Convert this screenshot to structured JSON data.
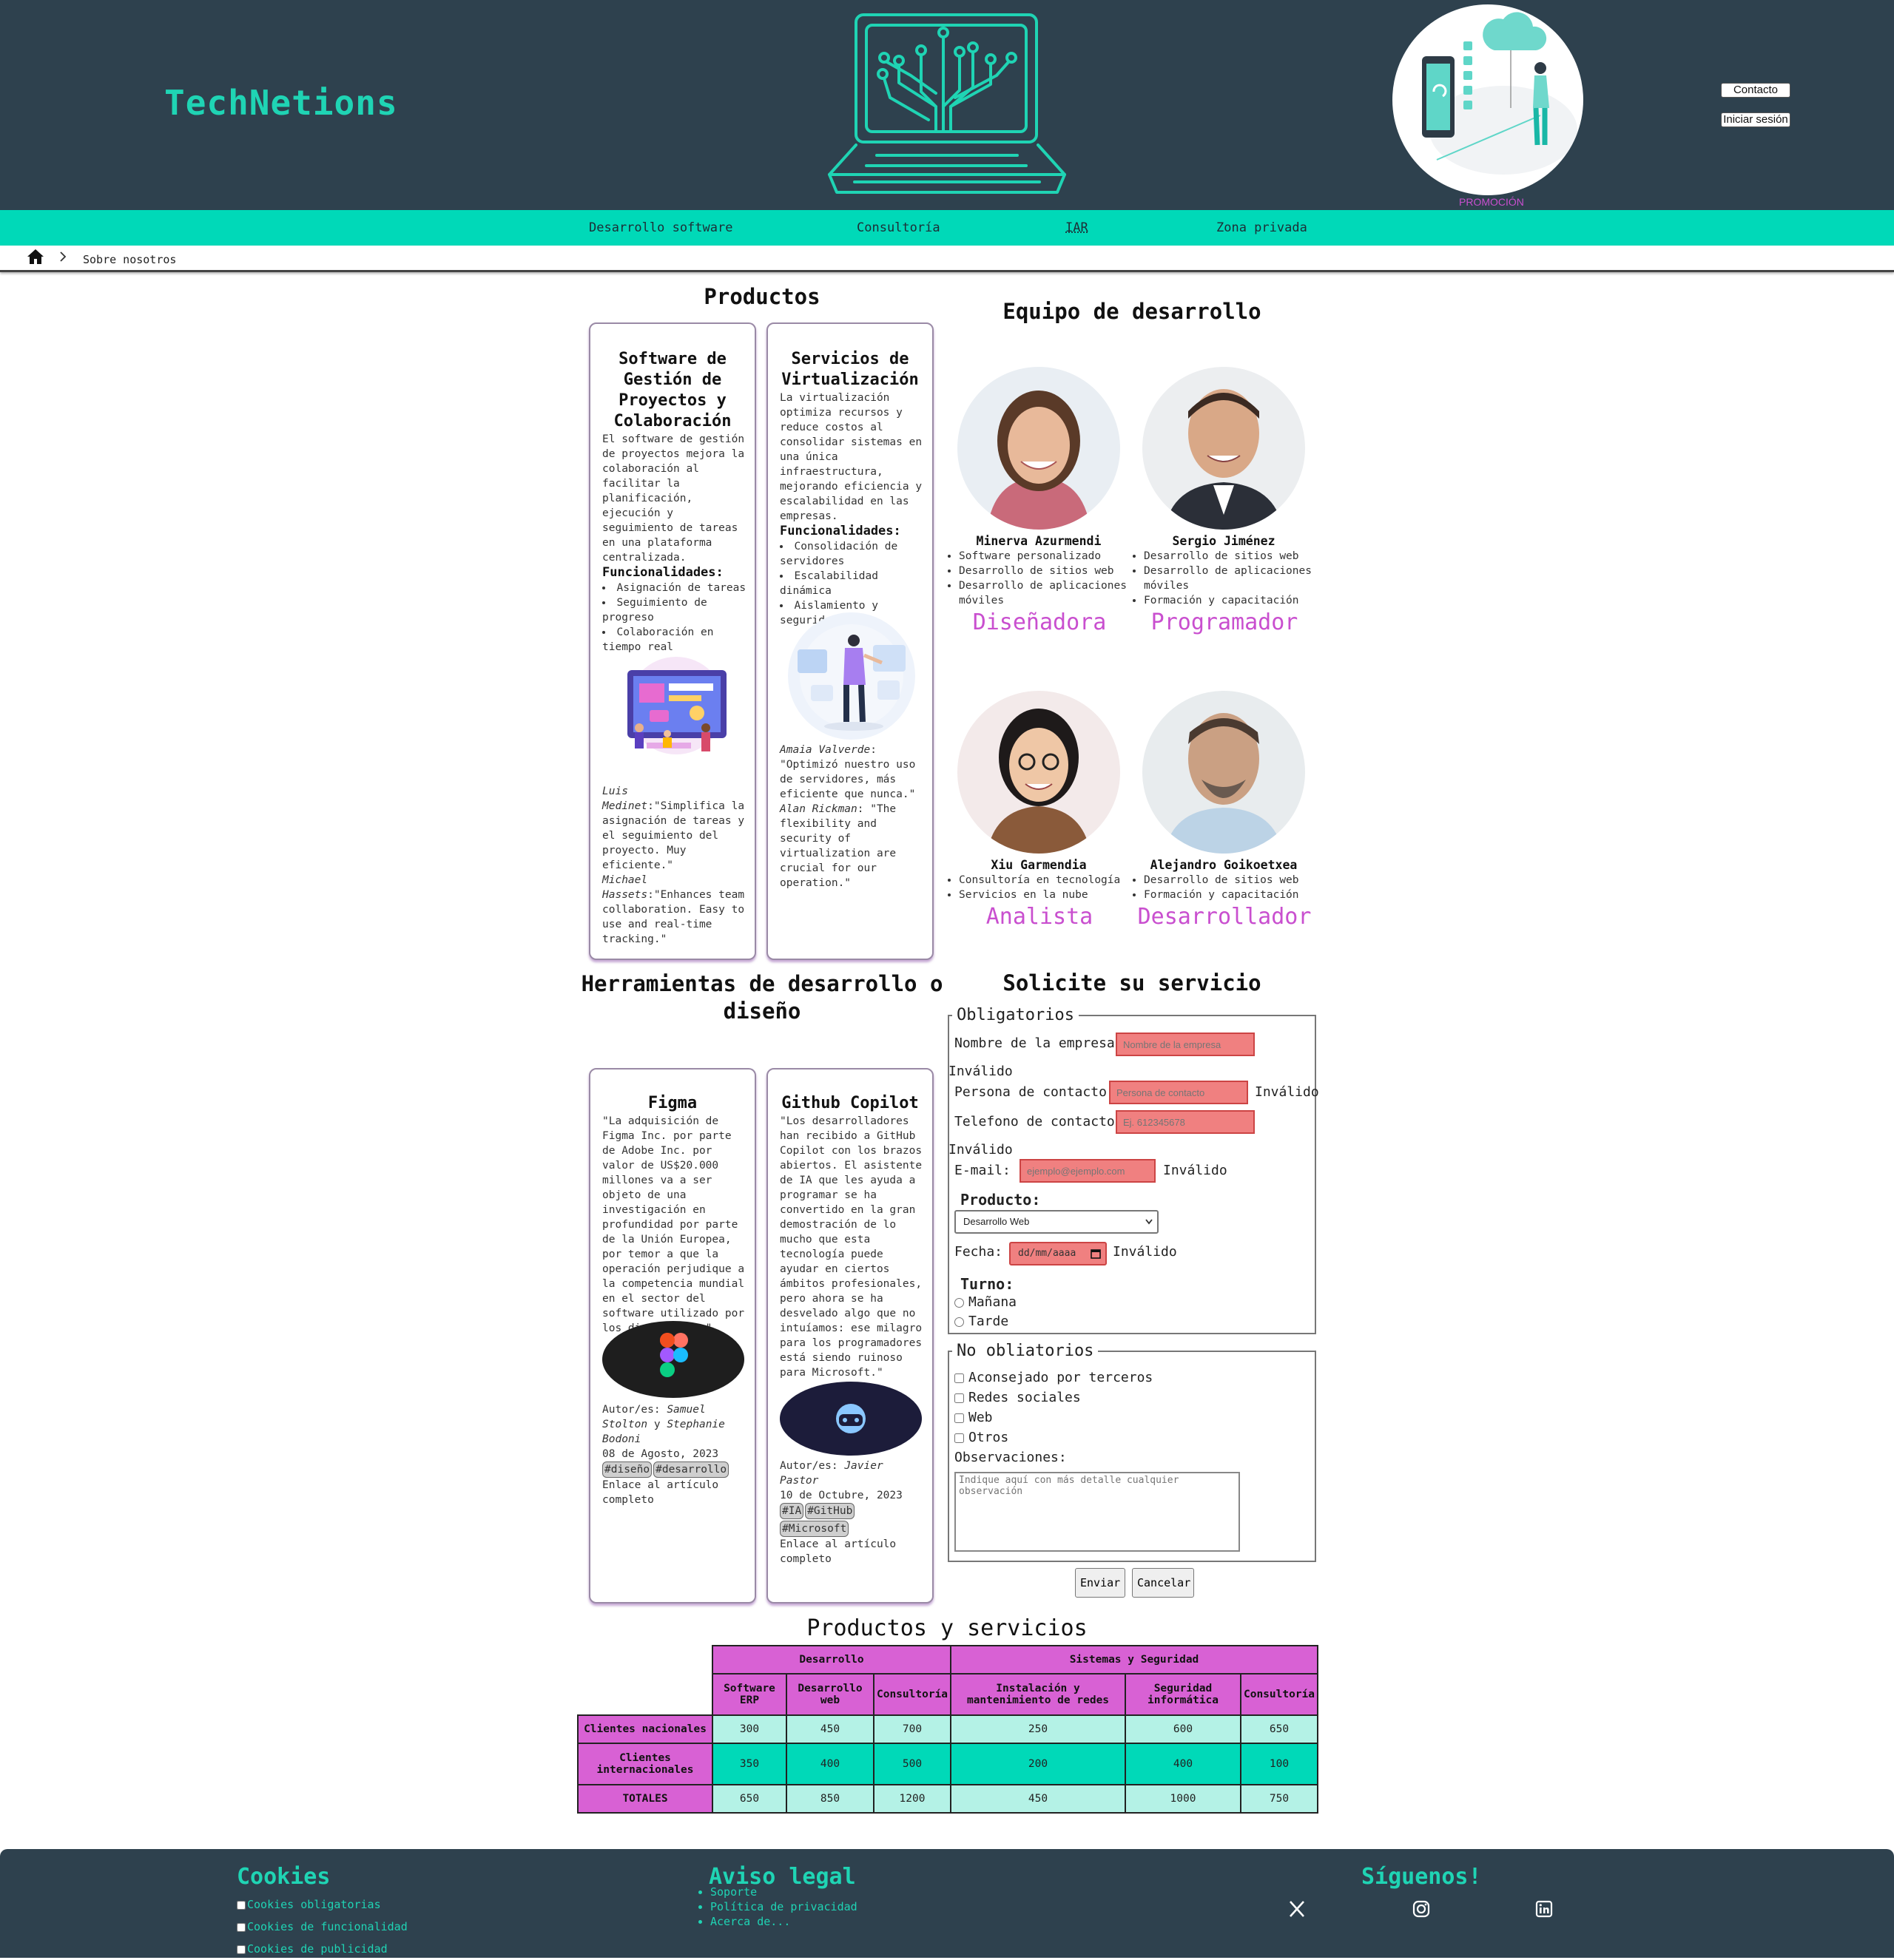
{
  "header": {
    "brand": "TechNetions",
    "promo_label": "PROMOCIÓN",
    "contact_button": "Contacto",
    "login_button": "Iniciar sesión"
  },
  "nav": {
    "items": [
      {
        "label": "Desarrollo software"
      },
      {
        "label": "Consultoría"
      },
      {
        "label": "IAR"
      },
      {
        "label": "Zona privada"
      }
    ]
  },
  "breadcrumb": {
    "current": "Sobre nosotros"
  },
  "products": {
    "title": "Productos",
    "cards": [
      {
        "title": "Software de Gestión de Proyectos y Colaboración",
        "description": "El software de gestión de proyectos mejora la colaboración al facilitar la planificación, ejecución y seguimiento de tareas en una plataforma centralizada.",
        "features_label": "Funcionalidades:",
        "features": [
          "Asignación de tareas",
          "Seguimiento de progreso",
          "Colaboración en tiempo real"
        ],
        "reviews": [
          {
            "author": "Luis Medinet",
            "text": ":\"Simplifica la asignación de tareas y el seguimiento del proyecto. Muy eficiente.\""
          },
          {
            "author": "Michael Hassets",
            "text": ":\"Enhances team collaboration. Easy to use and real-time tracking.\""
          }
        ]
      },
      {
        "title": "Servicios de Virtualización",
        "description": "La virtualización optimiza recursos y reduce costos al consolidar sistemas en una única infraestructura, mejorando eficiencia y escalabilidad en las empresas.",
        "features_label": "Funcionalidades:",
        "features": [
          "Consolidación de servidores",
          "Escalabilidad dinámica",
          "Aislamiento y seguridad"
        ],
        "reviews": [
          {
            "author": "Amaia Valverde",
            "text": ": \"Optimizó nuestro uso de servidores, más eficiente que nunca.\""
          },
          {
            "author": "Alan Rickman",
            "text": ": \"The flexibility and security of virtualization are crucial for our operation.\""
          }
        ]
      }
    ]
  },
  "team": {
    "title": "Equipo de desarrollo",
    "members": [
      {
        "name": "Minerva Azurmendi",
        "skills": [
          "Software personalizado",
          "Desarrollo de sitios web",
          "Desarrollo de aplicaciones móviles"
        ],
        "role": "Diseñadora"
      },
      {
        "name": "Sergio Jiménez",
        "skills": [
          "Desarrollo de sitios web",
          "Desarrollo de aplicaciones móviles",
          "Formación y capacitación"
        ],
        "role": "Programador"
      },
      {
        "name": "Xiu Garmendia",
        "skills": [
          "Consultoría en tecnología",
          "Servicios en la nube"
        ],
        "role": "Analista"
      },
      {
        "name": "Alejandro Goikoetxea",
        "skills": [
          "Desarrollo de sitios web",
          "Formación y capacitación"
        ],
        "role": "Desarrollador"
      }
    ]
  },
  "tools": {
    "title": "Herramientas de desarrollo o diseño",
    "cards": [
      {
        "title": "Figma",
        "text": "\"La adquisición de Figma Inc. por parte de Adobe Inc. por valor de US$20.000 millones va a ser objeto de una investigación en profundidad por parte de la Unión Europea, por temor a que la operación perjudique a la competencia mundial en el sector del software utilizado por los diseñadores.\"",
        "authors_label": "Autor/es:",
        "authors_a": "Samuel Stolton",
        "authors_and": " y ",
        "authors_b": "Stephanie Bodoni",
        "date": "08 de Agosto, 2023",
        "tags": [
          "#diseño",
          "#desarrollo"
        ],
        "link": "Enlace al artículo completo"
      },
      {
        "title": "Github Copilot",
        "text": "\"Los desarrolladores han recibido a GitHub Copilot con los brazos abiertos. El asistente de IA que les ayuda a programar se ha convertido en la gran demostración de lo mucho que esta tecnología puede ayudar en ciertos ámbitos profesionales, pero ahora se ha desvelado algo que no intuíamos: ese milagro para los programadores está siendo ruinoso para Microsoft.\"",
        "authors_label": "Autor/es:",
        "authors_a": "Javier Pastor",
        "date": "10 de Octubre, 2023",
        "tags": [
          "#IA",
          "#GitHub",
          "#Microsoft"
        ],
        "link": "Enlace al artículo completo"
      }
    ]
  },
  "form": {
    "title": "Solicite su servicio",
    "required_legend": "Obligatorios",
    "company_label": "Nombre de la empresa:",
    "company_placeholder": "Nombre de la empresa",
    "contact_label": "Persona de contacto:",
    "contact_placeholder": "Persona de contacto",
    "phone_label": "Telefono de contacto:",
    "phone_placeholder": "Ej. 612345678",
    "email_label": "E-mail:",
    "email_placeholder": "ejemplo@ejemplo.com",
    "invalid": "Inválido",
    "product_label": "Producto:",
    "product_selected": "Desarrollo Web",
    "date_label": "Fecha:",
    "date_placeholder": "dd/mm/aaaa",
    "shift_label": "Turno:",
    "shift_options": [
      "Mañana",
      "Tarde"
    ],
    "optional_legend": "No obliatorios",
    "optional_checks": [
      "Aconsejado por terceros",
      "Redes sociales",
      "Web",
      "Otros"
    ],
    "observations_label": "Observaciones:",
    "observations_placeholder": "Indique aquí con más detalle cualquier observación",
    "submit": "Enviar",
    "cancel": "Cancelar"
  },
  "table": {
    "title": "Productos y servicios",
    "groups": [
      "Desarrollo",
      "Sistemas y Seguridad"
    ],
    "columns": [
      "Software ERP",
      "Desarrollo web",
      "Consultoría",
      "Instalación y mantenimiento de redes",
      "Seguridad informática",
      "Consultoría"
    ],
    "rows": [
      {
        "label": "Clientes nacionales",
        "values": [
          "300",
          "450",
          "700",
          "250",
          "600",
          "650"
        ]
      },
      {
        "label": "Clientes internacionales",
        "values": [
          "350",
          "400",
          "500",
          "200",
          "400",
          "100"
        ]
      },
      {
        "label": "TOTALES",
        "values": [
          "650",
          "850",
          "1200",
          "450",
          "1000",
          "750"
        ]
      }
    ]
  },
  "footer": {
    "cookies_title": "Cookies",
    "cookies": [
      "Cookies obligatorias",
      "Cookies de funcionalidad",
      "Cookies de publicidad"
    ],
    "legal_title": "Aviso legal",
    "legal_links": [
      "Soporte",
      "Política de privacidad",
      "Acerca de..."
    ],
    "social_title": "Síguenos!",
    "social_icons": [
      "x-icon",
      "instagram-icon",
      "linkedin-icon"
    ]
  },
  "colors": {
    "header_bg": "#2e414e",
    "accent": "#00d9b8",
    "brand_text": "#1fd4b4",
    "role_pink": "#c94fcf",
    "table_header": "#d861d4"
  }
}
